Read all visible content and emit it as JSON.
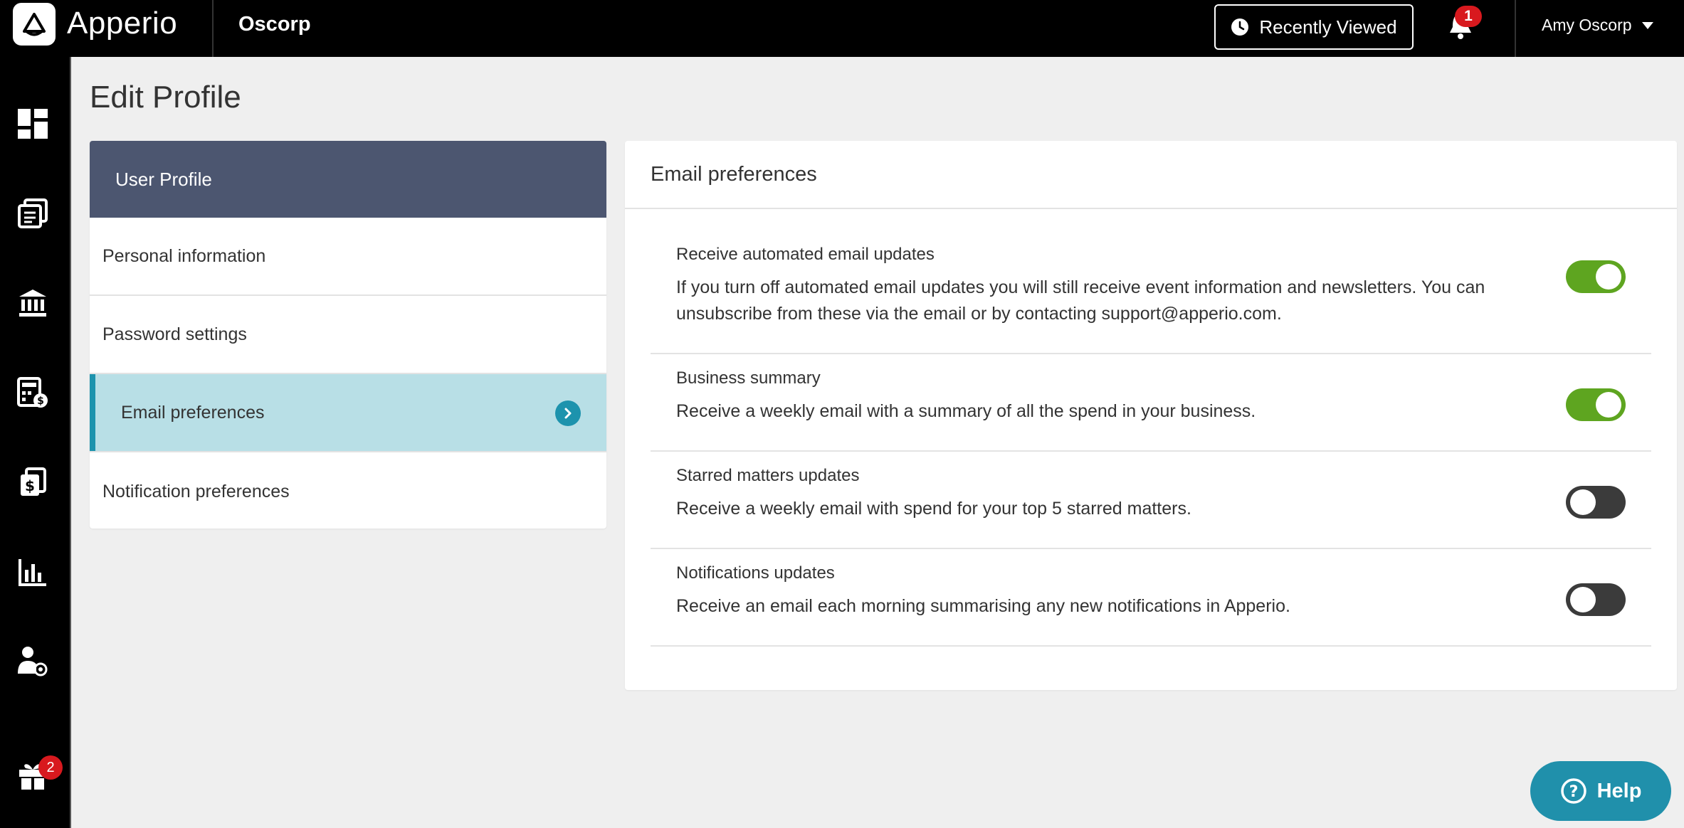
{
  "app": {
    "brand": "Apperio",
    "org": "Oscorp"
  },
  "header": {
    "recently_viewed_label": "Recently Viewed",
    "notification_count": "1",
    "user_name": "Amy Oscorp"
  },
  "sidebar": {
    "gift_badge": "2",
    "icons": [
      "dashboard-icon",
      "documents-icon",
      "bank-icon",
      "calculator-icon",
      "invoice-icon",
      "reports-icon",
      "user-settings-icon",
      "gift-icon"
    ]
  },
  "page": {
    "title": "Edit Profile"
  },
  "profile_menu": {
    "header": "User Profile",
    "items": [
      {
        "label": "Personal information"
      },
      {
        "label": "Password settings"
      },
      {
        "label": "Email preferences",
        "active": true
      },
      {
        "label": "Notification preferences"
      }
    ]
  },
  "email_prefs": {
    "title": "Email preferences",
    "items": [
      {
        "title": "Receive automated email updates",
        "desc": "If you turn off automated email updates you will still receive event information and newsletters. You can unsubscribe from these via the email or by contacting support@apperio.com.",
        "enabled": true
      },
      {
        "title": "Business summary",
        "desc": "Receive a weekly email with a summary of all the spend in your business.",
        "enabled": true
      },
      {
        "title": "Starred matters updates",
        "desc": "Receive a weekly email with spend for your top 5 starred matters.",
        "enabled": false
      },
      {
        "title": "Notifications updates",
        "desc": "Receive an email each morning summarising any new notifications in Apperio.",
        "enabled": false
      }
    ]
  },
  "help": {
    "label": "Help"
  },
  "colors": {
    "accent": "#1d93ad",
    "toggle_on": "#5ea520",
    "toggle_off": "#3b3b3b",
    "panel_header": "#4c5670",
    "badge": "#d8191e"
  }
}
